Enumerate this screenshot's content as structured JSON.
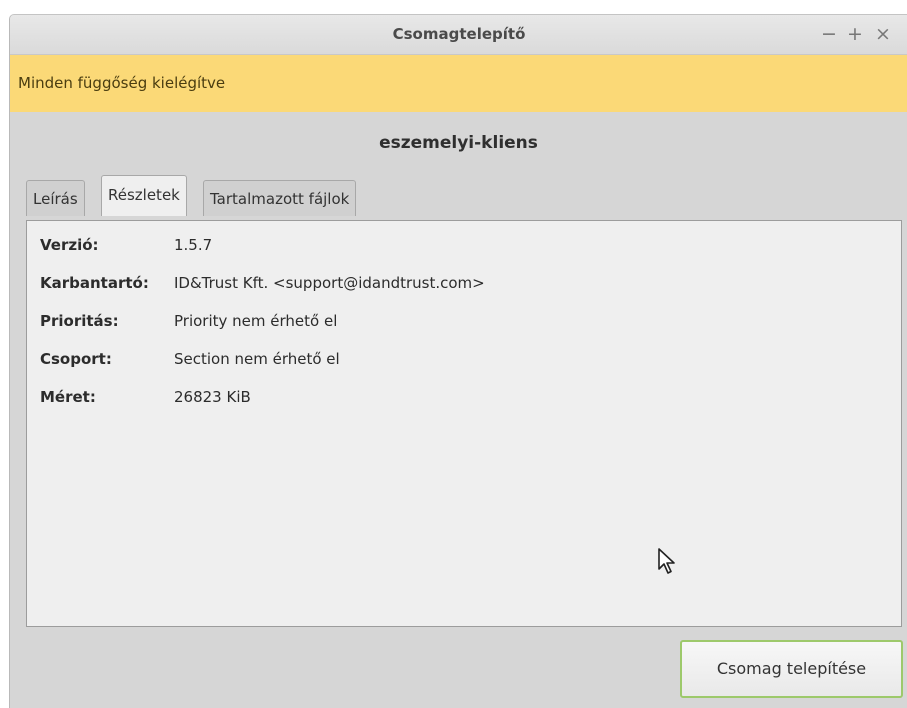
{
  "window": {
    "title": "Csomagtelepítő",
    "controls": {
      "minimize": "−",
      "maximize": "+",
      "close": "×"
    }
  },
  "infobar": {
    "message": "Minden függőség kielégítve",
    "color": "#fbd977"
  },
  "package": {
    "name": "eszemelyi-kliens"
  },
  "tabs": [
    {
      "label": "Leírás",
      "active": false
    },
    {
      "label": "Részletek",
      "active": true
    },
    {
      "label": "Tartalmazott fájlok",
      "active": false
    }
  ],
  "details": [
    {
      "key": "Verzió:",
      "value": "1.5.7"
    },
    {
      "key": "Karbantartó:",
      "value": "ID&Trust Kft. <support@idandtrust.com>"
    },
    {
      "key": "Prioritás:",
      "value": "Priority nem érhető el"
    },
    {
      "key": "Csoport:",
      "value": "Section nem érhető el"
    },
    {
      "key": "Méret:",
      "value": "26823 KiB"
    }
  ],
  "actions": {
    "install_label": "Csomag telepítése",
    "accent": "#9dc96b"
  },
  "icons": {
    "cursor": "mouse-pointer-icon"
  }
}
